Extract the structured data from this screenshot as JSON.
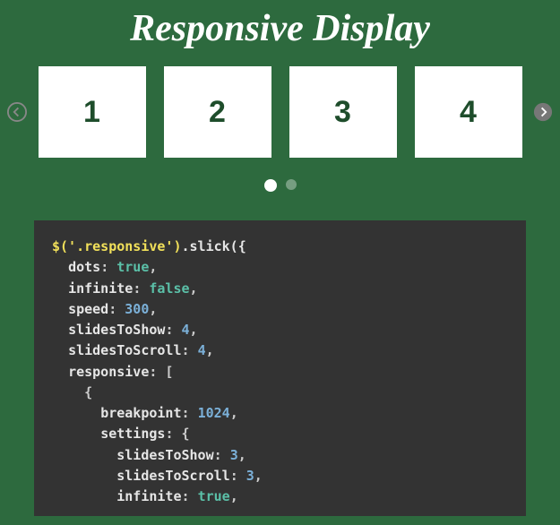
{
  "title": "Responsive Display",
  "carousel": {
    "slides": [
      "1",
      "2",
      "3",
      "4"
    ],
    "dots": [
      true,
      false
    ]
  },
  "code": {
    "selector": "$('.responsive')",
    "method": ".slick({",
    "lines": [
      {
        "indent": 1,
        "key": "dots",
        "value": "true",
        "vtype": "bool",
        "comma": true
      },
      {
        "indent": 1,
        "key": "infinite",
        "value": "false",
        "vtype": "bool",
        "comma": true
      },
      {
        "indent": 1,
        "key": "speed",
        "value": "300",
        "vtype": "num",
        "comma": true
      },
      {
        "indent": 1,
        "key": "slidesToShow",
        "value": "4",
        "vtype": "num",
        "comma": true
      },
      {
        "indent": 1,
        "key": "slidesToScroll",
        "value": "4",
        "vtype": "num",
        "comma": true
      },
      {
        "indent": 1,
        "key": "responsive",
        "raw": ": [",
        "vtype": "raw"
      },
      {
        "indent": 2,
        "raw": "{",
        "vtype": "raw"
      },
      {
        "indent": 3,
        "key": "breakpoint",
        "value": "1024",
        "vtype": "num",
        "comma": true
      },
      {
        "indent": 3,
        "key": "settings",
        "raw": ": {",
        "vtype": "raw"
      },
      {
        "indent": 4,
        "key": "slidesToShow",
        "value": "3",
        "vtype": "num",
        "comma": true
      },
      {
        "indent": 4,
        "key": "slidesToScroll",
        "value": "3",
        "vtype": "num",
        "comma": true
      },
      {
        "indent": 4,
        "key": "infinite",
        "value": "true",
        "vtype": "bool",
        "comma": true
      }
    ]
  }
}
